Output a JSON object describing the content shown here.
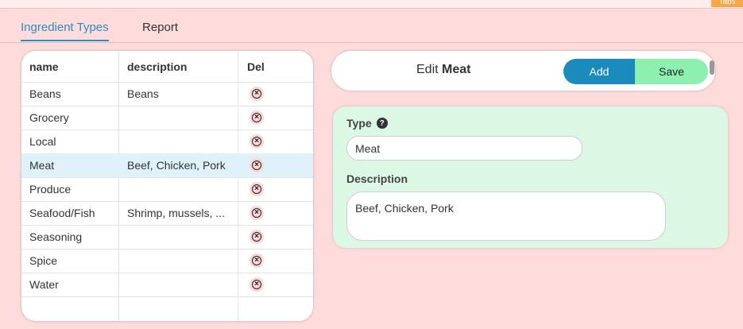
{
  "top_tab": {
    "label": "Tabs"
  },
  "tabs": [
    {
      "label": "Ingredient Types",
      "active": true
    },
    {
      "label": "Report",
      "active": false
    }
  ],
  "table": {
    "headers": {
      "name": "name",
      "description": "description",
      "del": "Del"
    },
    "rows": [
      {
        "name": "Beans",
        "description": "Beans"
      },
      {
        "name": "Grocery",
        "description": ""
      },
      {
        "name": "Local",
        "description": ""
      },
      {
        "name": "Meat",
        "description": "Beef, Chicken, Pork",
        "selected": true
      },
      {
        "name": "Produce",
        "description": ""
      },
      {
        "name": "Seafood/Fish",
        "description": "Shrimp, mussels, ..."
      },
      {
        "name": "Seasoning",
        "description": ""
      },
      {
        "name": "Spice",
        "description": ""
      },
      {
        "name": "Water",
        "description": ""
      }
    ],
    "delete_icon": "circle-x-icon"
  },
  "edit": {
    "prefix": "Edit",
    "item": "Meat",
    "add_label": "Add",
    "save_label": "Save"
  },
  "form": {
    "type_label": "Type",
    "type_value": "Meat",
    "help_icon": "question-circle-icon",
    "description_label": "Description",
    "description_value": "Beef, Chicken, Pork"
  },
  "colors": {
    "page_bg": "#ffdcdc",
    "accent": "#2a8cc0",
    "add_button": "#1b8bbd",
    "save_button": "#8ef0b0",
    "form_bg": "#dcf7e4",
    "selected_row": "#dff2fa"
  }
}
